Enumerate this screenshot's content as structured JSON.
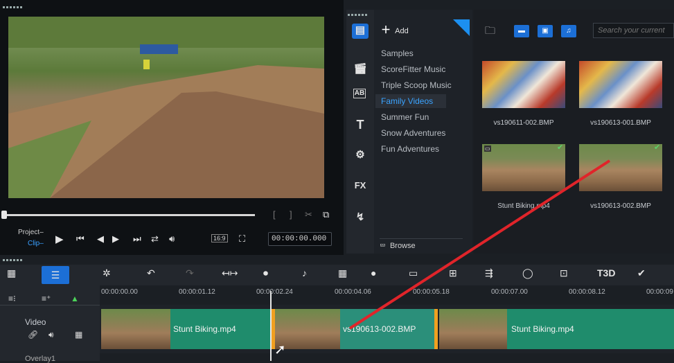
{
  "player": {
    "project_label": "Project",
    "clip_label": "Clip",
    "aspect_label": "16:9",
    "timecode": "00:00:00.000"
  },
  "library": {
    "add_label": "Add",
    "folders": [
      {
        "label": "Samples",
        "active": false
      },
      {
        "label": "ScoreFitter Music",
        "active": false
      },
      {
        "label": "Triple Scoop Music",
        "active": false
      },
      {
        "label": "Family Videos",
        "active": true
      },
      {
        "label": "Summer Fun",
        "active": false
      },
      {
        "label": "Snow Adventures",
        "active": false
      },
      {
        "label": "Fun Adventures",
        "active": false
      }
    ],
    "browse_label": "Browse",
    "search_placeholder": "Search your current",
    "thumbnails": [
      {
        "label": "vs190611-002.BMP",
        "kind": "party",
        "checked": false
      },
      {
        "label": "vs190613-001.BMP",
        "kind": "party",
        "checked": false
      },
      {
        "label": "Stunt Biking.mp4",
        "kind": "dirt",
        "checked": true
      },
      {
        "label": "vs190613-002.BMP",
        "kind": "dirt",
        "checked": true
      }
    ]
  },
  "rail": {
    "ab_label": "AB",
    "text_label": "T",
    "fx_label": "FX"
  },
  "timeline": {
    "ruler_ticks": [
      "00:00:00.00",
      "00:00:01.12",
      "00:00:02.24",
      "00:00:04.06",
      "00:00:05.18",
      "00:00:07.00",
      "00:00:08.12",
      "00:00:09"
    ],
    "track_labels": {
      "video": "Video",
      "overlay": "Overlay1"
    },
    "clips": [
      {
        "label": "Stunt Biking.mp4",
        "selected": false
      },
      {
        "label": "vs190613-002.BMP",
        "selected": true
      },
      {
        "label": "Stunt Biking.mp4",
        "selected": false
      }
    ],
    "t3d_label": "T3D"
  },
  "colors": {
    "accent_blue": "#1c6fd6",
    "active_folder": "#3aa3ff",
    "clip_green": "#1f8c6c",
    "selection_orange": "#f0a020",
    "annotation_red": "#e0242a"
  }
}
